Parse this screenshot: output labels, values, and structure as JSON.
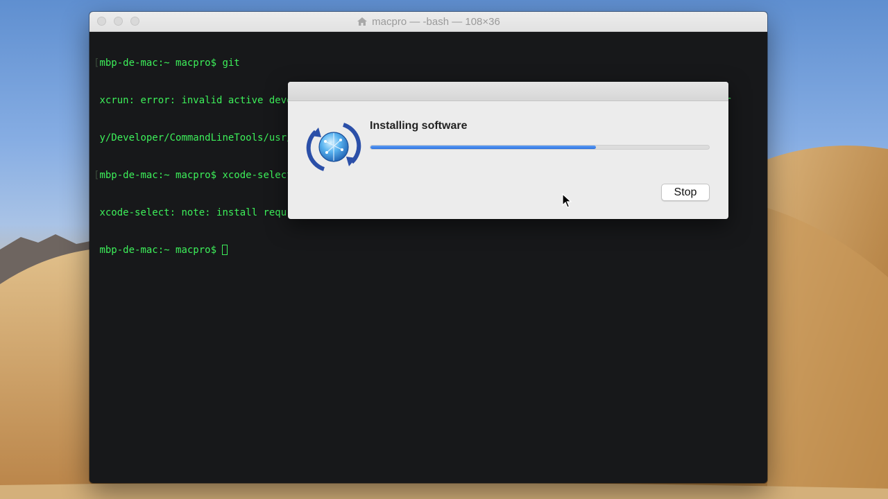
{
  "terminal": {
    "window_title": "macpro — -bash — 108×36",
    "lines": [
      {
        "text": "mbp-de-mac:~ macpro$ git",
        "bracketed": true
      },
      {
        "text": "xcrun: error: invalid active developer path (/Library/Developer/CommandLineTools), missing xcrun at: /Librar",
        "bracketed": false
      },
      {
        "text": "y/Developer/CommandLineTools/usr/bin/xcrun",
        "bracketed": false
      },
      {
        "text": "mbp-de-mac:~ macpro$ xcode-select --install",
        "bracketed": true
      },
      {
        "text": "xcode-select: note: install requ",
        "bracketed": false
      },
      {
        "text": "mbp-de-mac:~ macpro$ ",
        "bracketed": false,
        "cursor": true
      }
    ],
    "text_color": "#3df05a"
  },
  "dialog": {
    "title": "Installing software",
    "progress_fraction": 0.665,
    "stop_label": "Stop",
    "icon": "software-update-icon"
  },
  "colors": {
    "accent": "#3478f6"
  }
}
